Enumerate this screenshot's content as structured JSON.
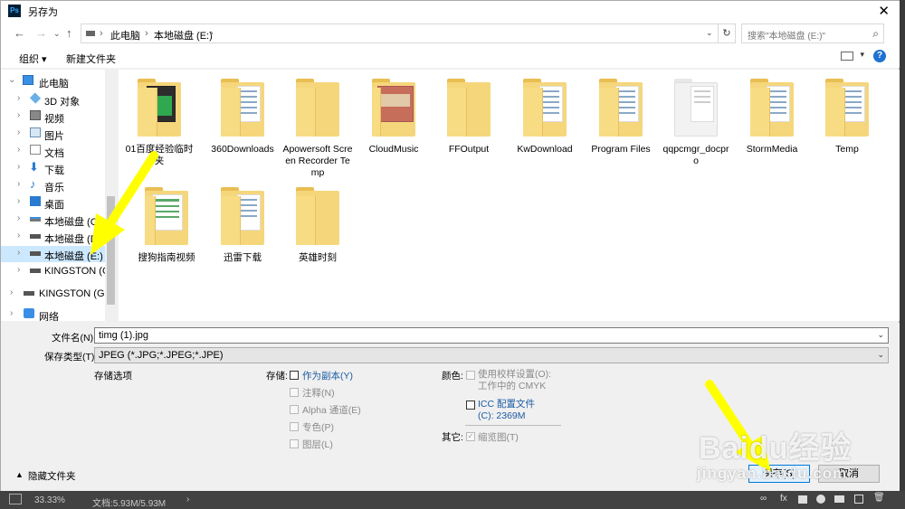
{
  "window": {
    "title": "另存为",
    "close_icon": "close-icon"
  },
  "nav": {
    "breadcrumb": [
      "此电脑",
      "本地磁盘 (E:)"
    ],
    "search_placeholder": "搜索\"本地磁盘 (E:)\""
  },
  "toolbar": {
    "organize": "组织 ▾",
    "new_folder": "新建文件夹"
  },
  "tree": [
    {
      "label": "此电脑",
      "icon": "pc-icon",
      "expanded": true
    },
    {
      "label": "3D 对象",
      "icon": "3d-objects-icon"
    },
    {
      "label": "视频",
      "icon": "video-icon"
    },
    {
      "label": "图片",
      "icon": "pictures-icon"
    },
    {
      "label": "文档",
      "icon": "documents-icon"
    },
    {
      "label": "下载",
      "icon": "download-icon"
    },
    {
      "label": "音乐",
      "icon": "music-icon"
    },
    {
      "label": "桌面",
      "icon": "desktop-icon"
    },
    {
      "label": "本地磁盘 (C:)",
      "icon": "drive-icon"
    },
    {
      "label": "本地磁盘 (D:)",
      "icon": "drive-icon"
    },
    {
      "label": "本地磁盘 (E:)",
      "icon": "drive-icon",
      "selected": true
    },
    {
      "label": "KINGSTON (G:",
      "icon": "usb-drive-icon"
    },
    {
      "label": "KINGSTON (G:)",
      "icon": "usb-drive-icon"
    },
    {
      "label": "网络",
      "icon": "network-icon"
    }
  ],
  "files": [
    {
      "name": "01百度经验临时夹",
      "kind": "folder-green"
    },
    {
      "name": "360Downloads",
      "kind": "folder-docs"
    },
    {
      "name": "Apowersoft Screen Recorder Temp",
      "kind": "folder"
    },
    {
      "name": "CloudMusic",
      "kind": "folder-photo"
    },
    {
      "name": "FFOutput",
      "kind": "folder"
    },
    {
      "name": "KwDownload",
      "kind": "folder-docs"
    },
    {
      "name": "Program Files",
      "kind": "folder-docs"
    },
    {
      "name": "qqpcmgr_docpro",
      "kind": "folder-white"
    },
    {
      "name": "StormMedia",
      "kind": "folder-docs"
    },
    {
      "name": "Temp",
      "kind": "folder-docs"
    },
    {
      "name": "搜狗指南视频",
      "kind": "folder-sheet"
    },
    {
      "name": "迅雷下载",
      "kind": "folder-docs"
    },
    {
      "name": "英雄时刻",
      "kind": "folder"
    }
  ],
  "form": {
    "filename_label": "文件名(N):",
    "filename_value": "timg (1).jpg",
    "filetype_label": "保存类型(T):",
    "filetype_value": "JPEG (*.JPG;*.JPEG;*.JPE)",
    "save_options_label": "存储选项",
    "storage_label": "存储:",
    "as_copy": "作为副本(Y)",
    "notes": "注释(N)",
    "alpha": "Alpha 通道(E)",
    "spot": "专色(P)",
    "layers": "图层(L)",
    "color_label": "颜色:",
    "use_proof": "使用校样设置(O): 工作中的 CMYK",
    "icc": "ICC 配置文件(C): 2369M",
    "other_label": "其它:",
    "thumbnail": "缩览图(T)",
    "hide_folders": "隐藏文件夹",
    "save_button": "保存(S)",
    "cancel_button": "取消"
  },
  "status": {
    "zoom": "33.33%",
    "doc": "文档:5.93M/5.93M"
  },
  "watermark": {
    "brand": "Baidu经验",
    "url": "jingyan.baidu.com"
  },
  "colors": {
    "selection": "#cce8ff",
    "folder": "#f5d67b",
    "arrow": "#ffff00",
    "accent": "#1e73d2"
  }
}
